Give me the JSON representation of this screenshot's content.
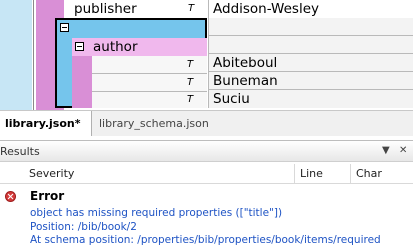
{
  "grid": {
    "rows": [
      {
        "name": "publisher",
        "type": "T",
        "value": "Addison-Wesley"
      },
      {
        "name": "author"
      },
      {
        "type": "T",
        "value": "Abiteboul"
      },
      {
        "type": "T",
        "value": "Buneman"
      },
      {
        "type": "T",
        "value": "Suciu"
      }
    ],
    "colors": {
      "blue_band": "#75c5ec",
      "pink_band": "#d98fd6",
      "light_blue": "#cfeaf6",
      "light_pink": "#f1d1f0",
      "selection": "#000000"
    }
  },
  "tabs": [
    {
      "label": "library.json*"
    },
    {
      "label": "library_schema.json"
    }
  ],
  "results": {
    "title": "Results",
    "columns": [
      "Severity",
      "Line",
      "Char"
    ],
    "error": {
      "severity": "Error",
      "lines": [
        "object has missing required properties ([\"title\"])",
        "Position: /bib/book/2",
        "At schema position: /properties/bib/properties/book/items/required"
      ]
    },
    "header_buttons": {
      "menu": "▼",
      "close": "✕"
    }
  }
}
